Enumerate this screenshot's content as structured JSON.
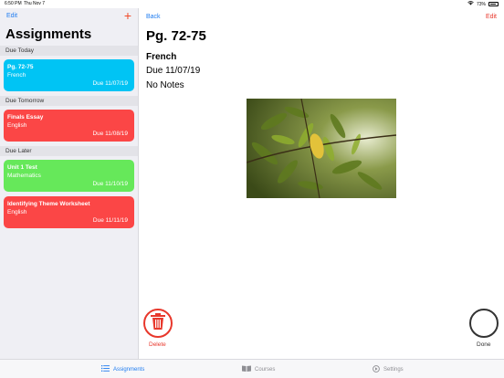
{
  "status": {
    "time": "6:50 PM",
    "date": "Thu Nov 7",
    "battery": "73%"
  },
  "sidebar": {
    "edit_label": "Edit",
    "add_icon": "plus-icon",
    "title": "Assignments",
    "sections": [
      {
        "label": "Due Today",
        "cards": [
          {
            "title": "Pg. 72-75",
            "course": "French",
            "due": "Due 11/07/19",
            "color": "#00c4f4"
          }
        ]
      },
      {
        "label": "Due Tomorrow",
        "cards": [
          {
            "title": "Finals Essay",
            "course": "English",
            "due": "Due 11/08/19",
            "color": "#fb4646"
          }
        ]
      },
      {
        "label": "Due Later",
        "cards": [
          {
            "title": "Unit 1 Test",
            "course": "Mathematics",
            "due": "Due 11/10/19",
            "color": "#66e85a"
          },
          {
            "title": "Identifying Theme Worksheet",
            "course": "English",
            "due": "Due 11/11/19",
            "color": "#fb4646"
          }
        ]
      }
    ]
  },
  "detail": {
    "back_label": "Back",
    "edit_label": "Edit",
    "title": "Pg. 72-75",
    "course": "French",
    "due": "Due 11/07/19",
    "notes": "No Notes",
    "delete_label": "Delete",
    "done_label": "Done"
  },
  "tabbar": {
    "tabs": [
      {
        "label": "Assignments",
        "icon": "list-icon",
        "active": true
      },
      {
        "label": "Courses",
        "icon": "book-icon",
        "active": false
      },
      {
        "label": "Settings",
        "icon": "settings-icon",
        "active": false
      }
    ]
  },
  "colors": {
    "accent": "#1f7cf0",
    "destructive": "#e8382c"
  }
}
